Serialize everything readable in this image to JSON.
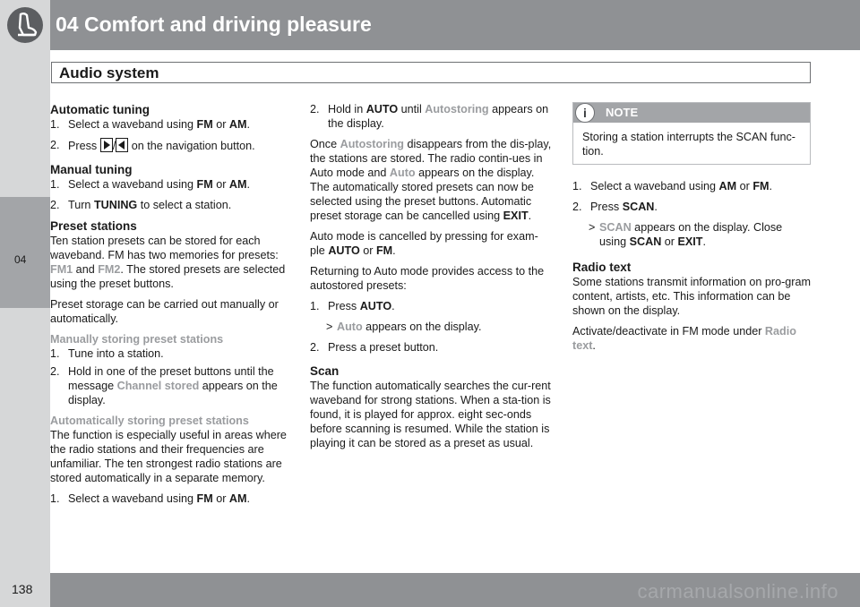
{
  "header": {
    "chapter_title": "04 Comfort and driving pleasure",
    "section_title": "Audio system"
  },
  "side_tab": {
    "label": "04"
  },
  "footer": {
    "page_number": "138",
    "watermark": "carmanualsonline.info"
  },
  "col1": {
    "auto_tuning_heading": "Automatic tuning",
    "auto_steps": [
      {
        "n": "1.",
        "a": "Select a waveband using ",
        "b1": "FM",
        "m": " or ",
        "b2": "AM",
        "e": "."
      },
      {
        "n": "2.",
        "a": "Press ",
        "sep": "/",
        "e": " on the navigation button."
      }
    ],
    "manual_tuning_heading": "Manual tuning",
    "manual_steps": [
      {
        "n": "1.",
        "a": "Select a waveband using ",
        "b1": "FM",
        "m": " or ",
        "b2": "AM",
        "e": "."
      },
      {
        "n": "2.",
        "a": "Turn ",
        "b1": "TUNING",
        "e": " to select a station."
      }
    ],
    "presets_heading": "Preset stations",
    "presets_p1": {
      "a": "Ten station presets can be stored for each waveband. FM has two memories for presets: ",
      "g1": "FM1",
      "m": " and ",
      "g2": "FM2",
      "e": ". The stored presets are selected using the preset buttons."
    },
    "presets_p2": "Preset storage can be carried out manually or automatically.",
    "manual_store_heading": "Manually storing preset stations",
    "manual_store_steps": [
      {
        "n": "1.",
        "a": "Tune into a station."
      },
      {
        "n": "2.",
        "a": "Hold in one of the preset buttons until the message ",
        "g": "Channel stored",
        "e": " appears on the display."
      }
    ],
    "auto_store_heading": "Automatically storing preset stations",
    "auto_store_p": "The function is especially useful in areas where the radio stations and their frequencies are unfamiliar. The ten strongest radio stations are stored automatically in a separate memory.",
    "auto_store_step1": {
      "n": "1.",
      "a": "Select a waveband using ",
      "b1": "FM",
      "m": " or ",
      "b2": "AM",
      "e": "."
    }
  },
  "col2": {
    "step2": {
      "n": "2.",
      "a": "Hold in ",
      "b": "AUTO",
      "m": " until ",
      "g": "Autostoring",
      "e": " appears on the display."
    },
    "p1": {
      "a": "Once ",
      "g1": "Autostoring",
      "m": " disappears from the dis-play, the stations are stored. The radio contin-ues in Auto mode and ",
      "g2": "Auto",
      "e": " appears on the display. The automatically stored presets can now be selected using the preset buttons. Automatic preset storage can be cancelled using ",
      "b": "EXIT",
      "f": "."
    },
    "p2": {
      "a": "Auto mode is cancelled by pressing for exam-ple ",
      "b1": "AUTO",
      "m": " or ",
      "b2": "FM",
      "e": "."
    },
    "p3": "Returning to Auto mode provides access to the autostored presets:",
    "steps": [
      {
        "n": "1.",
        "a": "Press ",
        "b": "AUTO",
        "e": "."
      }
    ],
    "sub": {
      "n": ">",
      "g": "Auto",
      "e": " appears on the display."
    },
    "step2b": {
      "n": "2.",
      "a": "Press a preset button."
    },
    "scan_heading": "Scan",
    "scan_p": "The function automatically searches the cur-rent waveband for strong stations. When a sta-tion is found, it is played for approx. eight sec-onds before scanning is resumed. While the station is playing it can be stored as a preset as usual."
  },
  "col3": {
    "note": {
      "title": "NOTE",
      "body": "Storing a station interrupts the SCAN func-tion."
    },
    "step1": {
      "n": "1.",
      "a": "Select a waveband using ",
      "b1": "AM",
      "m": " or ",
      "b2": "FM",
      "e": "."
    },
    "step2": {
      "n": "2.",
      "a": "Press ",
      "b": "SCAN",
      "e": "."
    },
    "sub": {
      "n": ">",
      "g": "SCAN",
      "a": " appears on the display. Close using ",
      "b1": "SCAN",
      "m": " or ",
      "b2": "EXIT",
      "e": "."
    },
    "radio_text_heading": "Radio text",
    "radio_text_p": "Some stations transmit information on pro-gram content, artists, etc. This information can be shown on the display.",
    "activate_p": {
      "a": "Activate/deactivate in FM mode under ",
      "g": "Radio text",
      "e": "."
    }
  }
}
